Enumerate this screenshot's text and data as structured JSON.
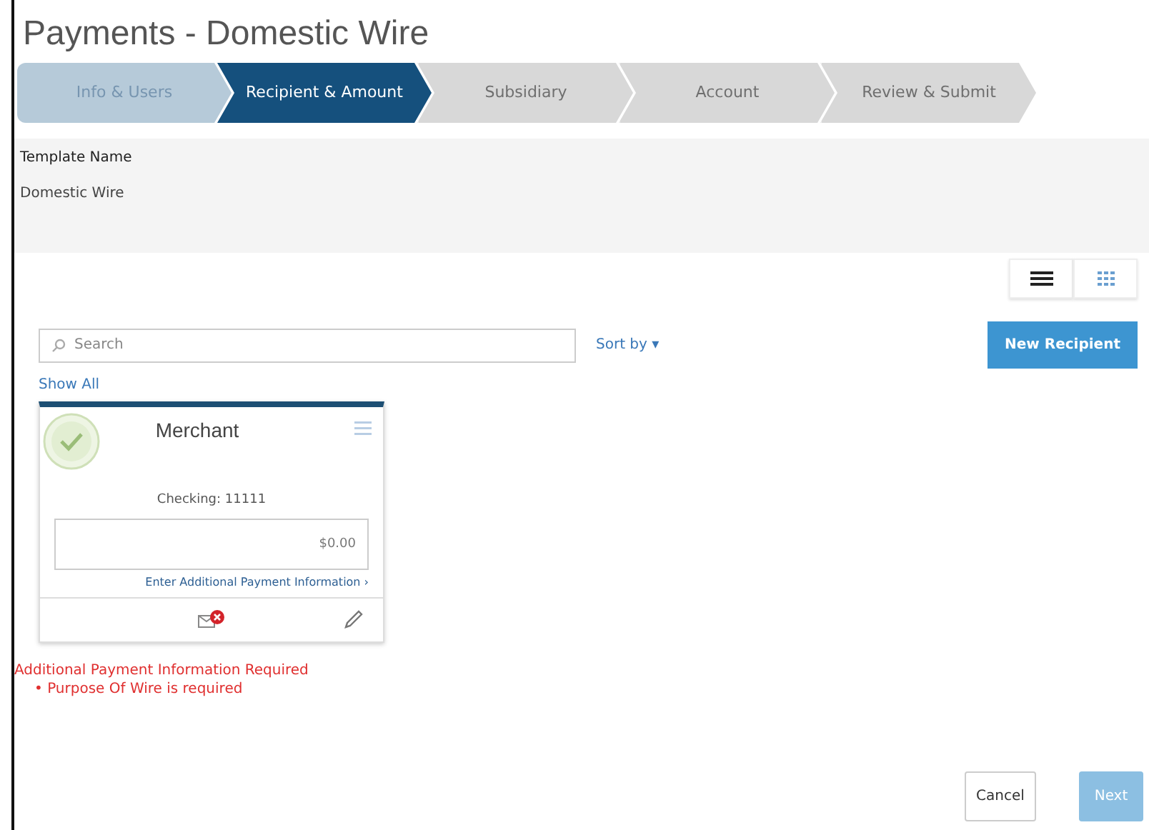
{
  "title": "Payments - Domestic Wire",
  "steps": [
    {
      "label": "Info & Users",
      "completed": true,
      "selected": false
    },
    {
      "label": "Recipient & Amount",
      "completed": false,
      "selected": true
    },
    {
      "label": "Subsidiary",
      "completed": false,
      "selected": false
    },
    {
      "label": "Account",
      "completed": false,
      "selected": false
    },
    {
      "label": "Review & Submit",
      "completed": false,
      "selected": false
    }
  ],
  "template": {
    "label": "Template Name",
    "value": "Domestic Wire"
  },
  "view_toggle": [
    {
      "kind": "list",
      "selected": true
    },
    {
      "kind": "grid",
      "selected": false
    }
  ],
  "search": {
    "placeholder": "Search"
  },
  "sort": {
    "label": "Sort by ▾"
  },
  "new_recipient": {
    "label": "New Recipient"
  },
  "show_all": "Show All",
  "card": {
    "name": "Merchant",
    "selected": true,
    "account": "Checking: 11111",
    "amount": "$0.00",
    "link": "Enter Additional Payment Information ›"
  },
  "errors": {
    "heading": "Additional Payment Information Required",
    "items": [
      "• Purpose Of Wire is required"
    ]
  },
  "cancel": {
    "label": "Cancel"
  },
  "next": {
    "label": "Next",
    "disabled": true
  }
}
